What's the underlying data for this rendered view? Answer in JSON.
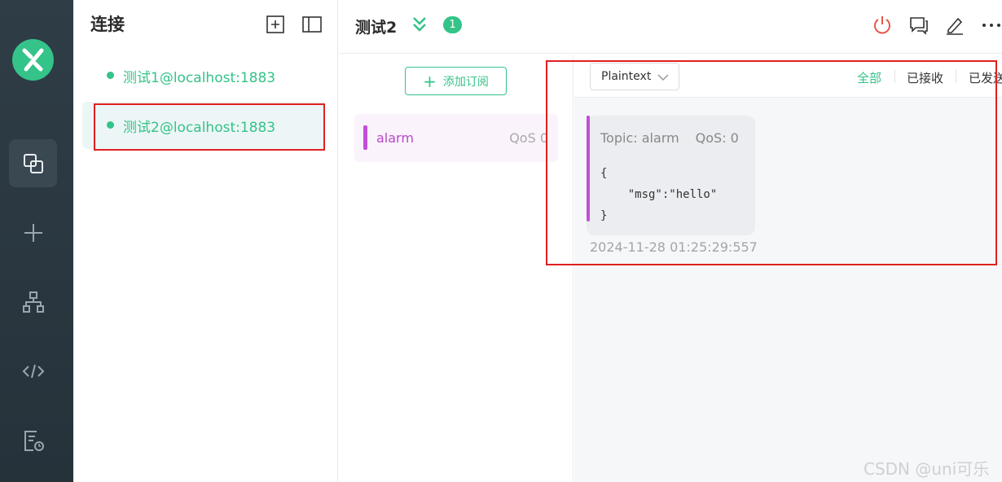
{
  "sidebar": {
    "nav": [
      "connections-icon",
      "add-icon",
      "topology-icon",
      "code-icon",
      "log-icon"
    ]
  },
  "connections": {
    "title": "连接",
    "items": [
      {
        "label": "测试1@localhost:1883",
        "status": "connected"
      },
      {
        "label": "测试2@localhost:1883",
        "status": "connected",
        "active": true
      }
    ]
  },
  "header": {
    "title": "测试2",
    "badge": "1"
  },
  "subscriptions": {
    "add_label": "添加订阅",
    "items": [
      {
        "topic": "alarm",
        "qos": "QoS 0",
        "color": "#c04fd8"
      }
    ]
  },
  "messages": {
    "format": "Plaintext",
    "filters": [
      "全部",
      "已接收",
      "已发送"
    ],
    "active_filter": "全部",
    "list": [
      {
        "topic": "Topic: alarm",
        "qos": "QoS: 0",
        "payload": "{\n    \"msg\":\"hello\"\n}",
        "time": "2024-11-28 01:25:29:557"
      }
    ]
  },
  "watermark": "CSDN @uni可乐",
  "colors": {
    "accent": "#34c388",
    "topic": "#c04fd8",
    "danger": "#e8564a",
    "annotation": "#e02020"
  }
}
